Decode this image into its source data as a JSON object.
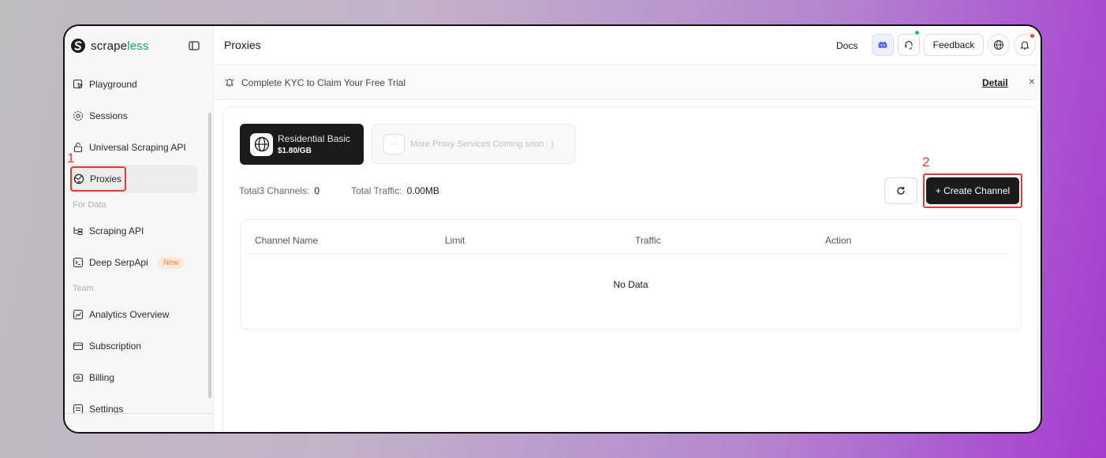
{
  "brand": {
    "name_main": "scrape",
    "name_accent": "less"
  },
  "sidebar": {
    "items_top": [
      {
        "label": "Playground",
        "icon": "playground-icon"
      },
      {
        "label": "Sessions",
        "icon": "sessions-icon"
      },
      {
        "label": "Universal Scraping API",
        "icon": "lock-icon"
      },
      {
        "label": "Proxies",
        "icon": "globe-icon"
      }
    ],
    "section_data": "For Data",
    "items_data": [
      {
        "label": "Scraping API",
        "icon": "scraping-api-icon"
      },
      {
        "label": "Deep SerpApi",
        "icon": "terminal-icon",
        "badge": "New"
      }
    ],
    "section_team": "Team",
    "items_team": [
      {
        "label": "Analytics Overview",
        "icon": "analytics-icon"
      },
      {
        "label": "Subscription",
        "icon": "card-icon"
      },
      {
        "label": "Billing",
        "icon": "billing-icon"
      },
      {
        "label": "Settings",
        "icon": "settings-icon"
      }
    ]
  },
  "annotations": {
    "step1": "1",
    "step2": "2"
  },
  "header": {
    "title": "Proxies",
    "docs": "Docs",
    "feedback": "Feedback"
  },
  "banner": {
    "text": "Complete KYC to Claim Your Free Trial",
    "detail": "Detail",
    "close": "×"
  },
  "services": {
    "active_title": "Residential Basic",
    "active_price": "$1.80/GB",
    "more_dots": "···",
    "more_text": "More Proxy Services Coming soon : )"
  },
  "stats": {
    "channels_label": "Total3 Channels:",
    "channels_value": "0",
    "traffic_label": "Total Traffic:",
    "traffic_value": "0.00MB"
  },
  "actions": {
    "create": "+ Create Channel"
  },
  "table": {
    "columns": [
      "Channel Name",
      "Limit",
      "Traffic",
      "Action"
    ],
    "empty": "No Data"
  },
  "colors": {
    "accent": "#16a37a",
    "annotation": "#e53935",
    "dark": "#1b1b1b"
  }
}
